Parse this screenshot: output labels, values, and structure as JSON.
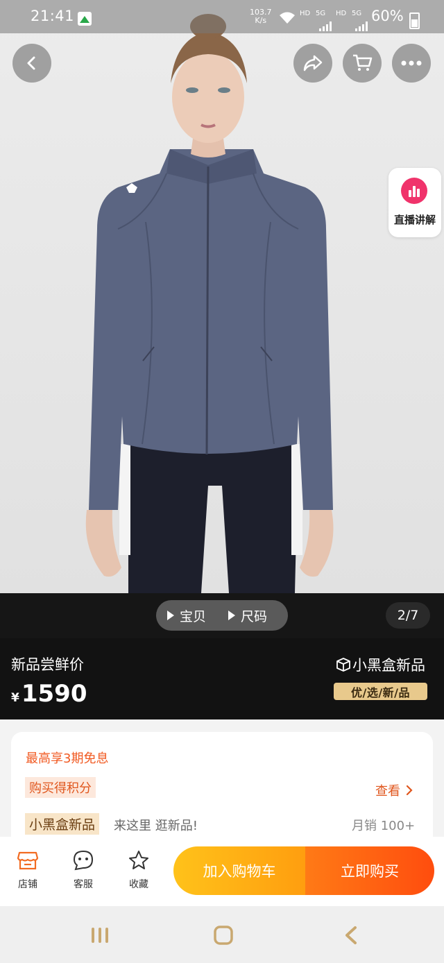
{
  "status_bar": {
    "time": "21:41",
    "net_speed_value": "103.7",
    "net_speed_unit": "K/s",
    "hd1": "HD",
    "sig1": "5G",
    "hd2": "HD",
    "sig2": "5G",
    "battery": "60%"
  },
  "header": {
    "back_icon": "back-icon",
    "share_icon": "share-icon",
    "cart_icon": "cart-icon",
    "more_icon": "more-icon"
  },
  "live": {
    "label": "直播讲解",
    "icon": "live-bars-icon",
    "color": "#f0336b"
  },
  "gallery": {
    "tabs": [
      "宝贝",
      "尺码"
    ],
    "counter": "2/7"
  },
  "price_block": {
    "label": "新品尝鲜价",
    "currency": "¥",
    "price": "1590",
    "brand": "小黑盒新品",
    "tagline": "优/选/新/品"
  },
  "info": {
    "promo": "最高享3期免息",
    "points": "购买得积分",
    "view": "查看",
    "new_tag": "小黑盒新品",
    "new_desc": "来这里 逛新品!",
    "sales": "月销 100+"
  },
  "actions": {
    "store": "店铺",
    "service": "客服",
    "favorite": "收藏",
    "add_cart": "加入购物车",
    "buy_now": "立即购买"
  },
  "colors": {
    "accent_orange": "#ff4d0e",
    "accent_yellow": "#ffc21a",
    "jacket": "#5b6582"
  }
}
